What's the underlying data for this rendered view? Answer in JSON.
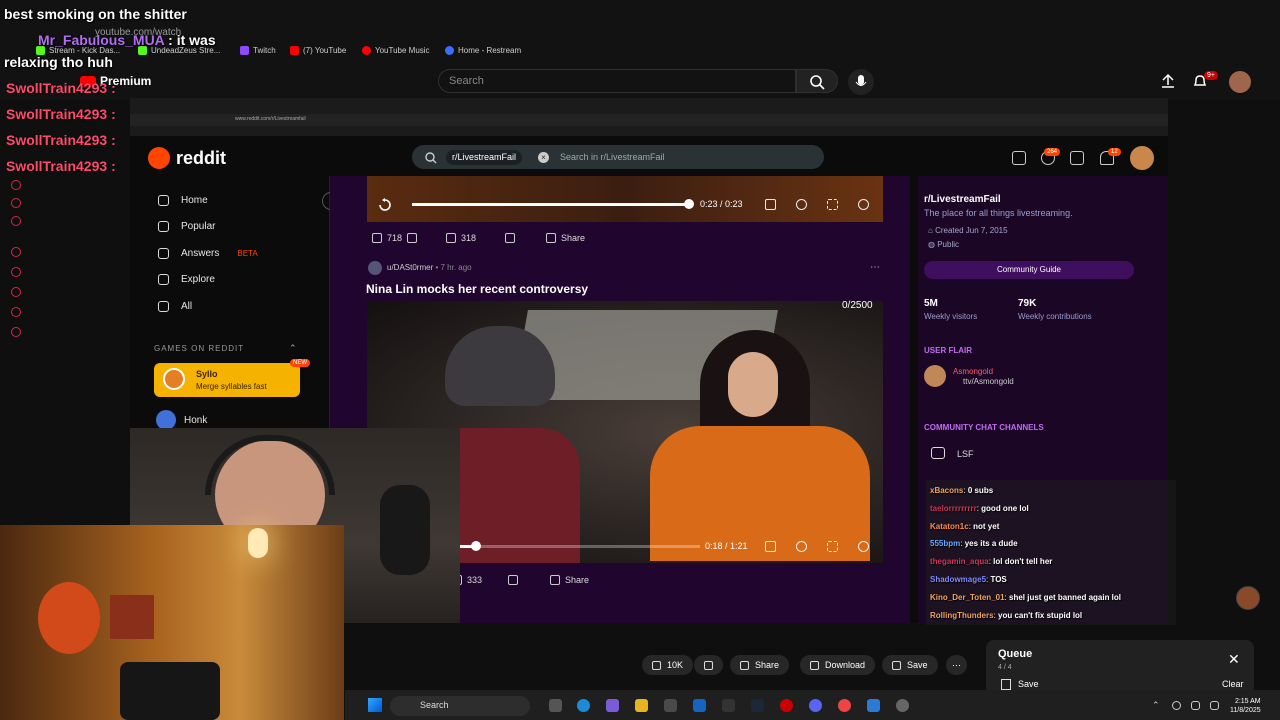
{
  "overlay": {
    "line1": "best smoking on the shitter",
    "user2": "Mr_Fabulous_MUA",
    "line2": ": it was",
    "line3": "relaxing tho huh",
    "spam_user": "SwollTrain4293",
    "spam_colon": ":"
  },
  "outer_browser": {
    "url": "youtube.com/watch",
    "bookmarks": [
      "Stream - Kick Das...",
      "UndeadZeus Stre...",
      "Twitch",
      "(7) YouTube",
      "YouTube Music",
      "Home - Restream"
    ]
  },
  "youtube": {
    "logo_label": "Premium",
    "search_placeholder": "Search",
    "notif_count": "9+",
    "actions": {
      "like_count": "10K",
      "share": "Share",
      "download": "Download",
      "save": "Save",
      "more": "⋯"
    },
    "queue": {
      "title": "Queue",
      "count": "4 / 4",
      "save": "Save",
      "clear": "Clear",
      "close": "✕"
    }
  },
  "reddit": {
    "wordmark": "reddit",
    "url": "www.reddit.com/r/Livestreamfail",
    "search_chip": "r/LivestreamFail",
    "search_placeholder": "Search in r/LivestreamFail",
    "badge_chat": "264",
    "badge_notif": "12",
    "nav": [
      "Home",
      "Popular",
      "Answers",
      "Explore",
      "All"
    ],
    "answers_badge": "BETA",
    "games_header": "GAMES ON REDDIT",
    "game1_title": "Syllo",
    "game1_sub": "Merge syllables fast",
    "game1_badge": "NEW",
    "game2_title": "Honk",
    "post1": {
      "time": "0:23 / 0:23",
      "votes": "718",
      "comments": "318",
      "share": "Share"
    },
    "post2": {
      "user": "u/DASt0rmer",
      "age": "• 7 hr. ago",
      "title": "Nina Lin mocks her recent controversy",
      "counter": "0/2500",
      "time": "0:18 / 1:21",
      "comments": "333",
      "share": "Share"
    },
    "panel": {
      "title": "r/LivestreamFail",
      "desc": "The place for all things livestreaming.",
      "created": "Created Jun 7, 2015",
      "visibility": "Public",
      "guide_btn": "Community Guide",
      "stat1_num": "5M",
      "stat1_lbl": "Weekly visitors",
      "stat2_num": "79K",
      "stat2_lbl": "Weekly contributions",
      "flair_header": "USER FLAIR",
      "flair_name": "Asmongold",
      "flair_tag": "ttv/Asmongold",
      "channels_header": "COMMUNITY CHAT CHANNELS",
      "channel1": "LSF"
    }
  },
  "twitch_chat": [
    {
      "user": "xBacons",
      "msg": "0 subs",
      "color": "#f0a35a"
    },
    {
      "user": "taelorrrrrrrrr",
      "msg": "good one lol",
      "color": "#d4325a"
    },
    {
      "user": "Kataton1c",
      "msg": "not yet",
      "color": "#ff8a4a"
    },
    {
      "user": "555bpm",
      "msg": "yes its a dude",
      "color": "#6aa8ff"
    },
    {
      "user": "thegamin_aqua",
      "msg": "lol don't tell her",
      "color": "#d4325a"
    },
    {
      "user": "Shadowmage5",
      "msg": "TOS",
      "color": "#7d8cff"
    },
    {
      "user": "Kino_Der_Toten_01",
      "msg": "shel just get banned again lol",
      "color": "#f0a35a"
    },
    {
      "user": "RollingThunders",
      "msg": "you can't fix stupid lol",
      "color": "#f0a35a"
    }
  ],
  "taskbar": {
    "search": "Search",
    "time": "2:15 AM",
    "date": "11/8/2025"
  },
  "colors": {
    "reddit_orange": "#ff4500",
    "feed_purple": "#20062e",
    "chat_red": "#ff4a6e"
  }
}
